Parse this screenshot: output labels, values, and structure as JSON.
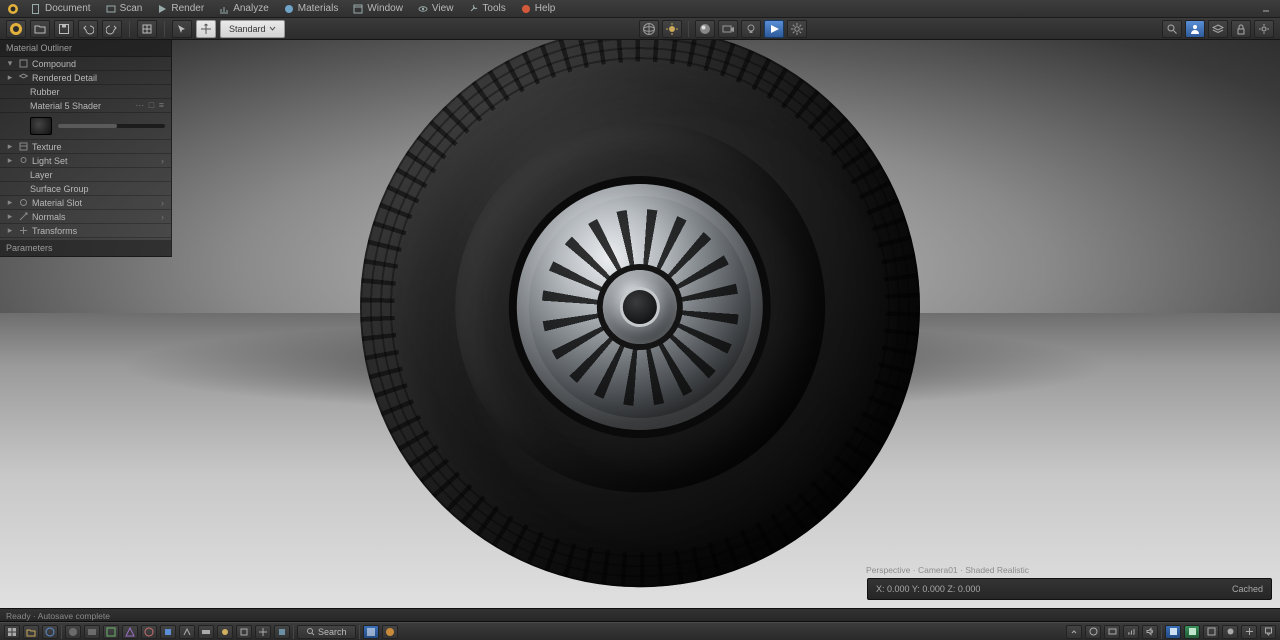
{
  "menubar": {
    "items": [
      {
        "label": "Document"
      },
      {
        "label": "Scan"
      },
      {
        "label": "Render"
      },
      {
        "label": "Analyze"
      },
      {
        "label": "Materials"
      },
      {
        "label": "Window"
      },
      {
        "label": "View"
      },
      {
        "label": "Tools"
      },
      {
        "label": "Help"
      }
    ]
  },
  "toolbar": {
    "undo": "Undo",
    "redo": "Redo",
    "save": "Save",
    "open": "Open",
    "select": "Select",
    "render_btn": "Render",
    "mode_label": "Standard"
  },
  "outliner": {
    "header": "Material Outliner",
    "items": [
      {
        "caret": "▾",
        "label": "Compound",
        "indent": 0
      },
      {
        "caret": "▸",
        "label": "Rendered Detail",
        "indent": 0
      },
      {
        "caret": "",
        "label": "Rubber",
        "indent": 1
      },
      {
        "caret": "",
        "label": "Material 5 Shader",
        "indent": 1,
        "dots": "⋯ □ ≡"
      },
      {
        "caret": "",
        "thumb": true,
        "indent": 2
      },
      {
        "caret": "▸",
        "label": "Texture",
        "indent": 0
      },
      {
        "caret": "▸",
        "label": "Light Set",
        "indent": 0,
        "dots": "›"
      },
      {
        "caret": "",
        "label": "Layer",
        "indent": 1
      },
      {
        "caret": "",
        "label": "Surface Group",
        "indent": 1
      },
      {
        "caret": "▸",
        "label": "Material Slot",
        "indent": 0,
        "dots": "›"
      },
      {
        "caret": "▸",
        "label": "Normals",
        "indent": 0,
        "dots": "›"
      },
      {
        "caret": "▸",
        "label": "Transforms",
        "indent": 0
      }
    ],
    "footer": "Parameters"
  },
  "infobar": {
    "title": "Perspective · Camera01 · Shaded Realistic",
    "coords": "X: 0.000  Y: 0.000  Z: 0.000",
    "fps": "Cached"
  },
  "statusline": "Ready · Autosave complete",
  "taskbar": {
    "search": "Search",
    "clock": "",
    "tray_items": 8
  },
  "colors": {
    "accent": "#4aa3df",
    "panel": "#2b2b2b"
  }
}
